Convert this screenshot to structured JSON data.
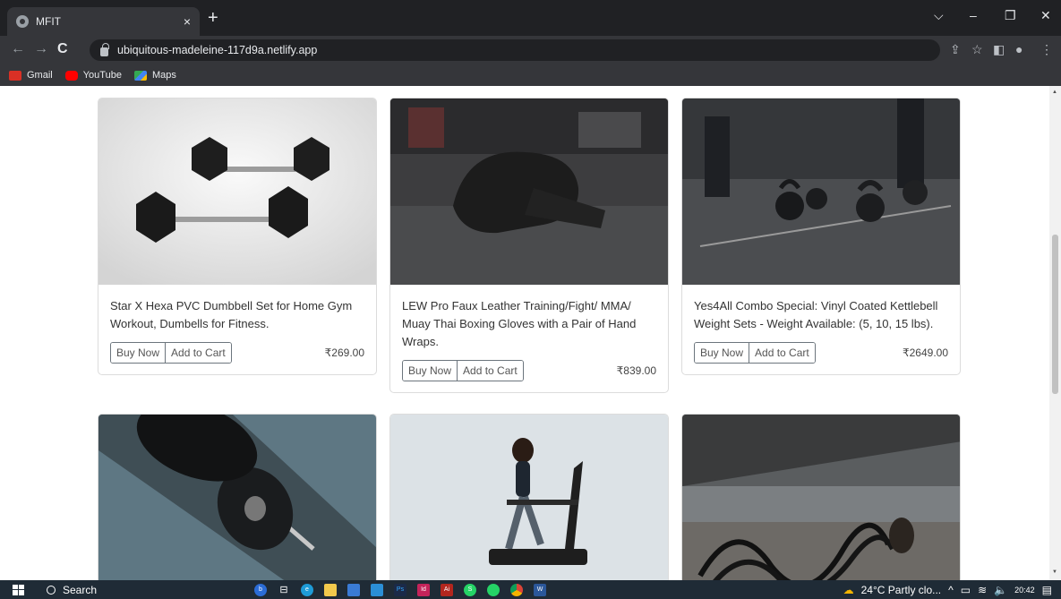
{
  "browser": {
    "tab_title": "MFIT",
    "tab_close": "×",
    "new_tab": "+",
    "window_controls": [
      "⌵",
      "–",
      "❐",
      "✕"
    ],
    "url": "ubiquitous-madeleine-117d9a.netlify.app",
    "nav": {
      "back": "←",
      "forward": "→",
      "reload": "C"
    },
    "toolbar_icons": [
      "share-icon",
      "star-icon",
      "sidepanel-icon",
      "profile-icon",
      "menu-icon"
    ],
    "bookmarks": [
      {
        "label": "Gmail",
        "icon": "gmail-icon",
        "color": "#d93025"
      },
      {
        "label": "YouTube",
        "icon": "youtube-icon",
        "color": "#ff0000"
      },
      {
        "label": "Maps",
        "icon": "maps-icon",
        "color": "#34a853"
      }
    ]
  },
  "products": [
    {
      "title": "Star X Hexa PVC Dumbbell Set for Home Gym Workout, Dumbells for Fitness.",
      "buy_label": "Buy Now",
      "cart_label": "Add to Cart",
      "price": "₹269.00",
      "image": "dumbbells"
    },
    {
      "title": "LEW Pro Faux Leather Training/Fight/ MMA/ Muay Thai Boxing Gloves with a Pair of Hand Wraps.",
      "buy_label": "Buy Now",
      "cart_label": "Add to Cart",
      "price": "₹839.00",
      "image": "boxing-gloves"
    },
    {
      "title": "Yes4All Combo Special: Vinyl Coated Kettlebell Weight Sets - Weight Available: (5, 10, 15 lbs).",
      "buy_label": "Buy Now",
      "cart_label": "Add to Cart",
      "price": "₹2649.00",
      "image": "kettlebells"
    },
    {
      "title": "",
      "image": "barbell"
    },
    {
      "title": "",
      "image": "treadmill"
    },
    {
      "title": "",
      "image": "battle-ropes"
    }
  ],
  "taskbar": {
    "search_label": "Search",
    "weather": "24°C  Partly clo...",
    "clock": "20:42",
    "apps": [
      {
        "icon": "bing-icon",
        "color": "#2b6cd6",
        "text": "b"
      },
      {
        "icon": "taskview-icon",
        "color": "#1f2b36",
        "text": "⊟"
      },
      {
        "icon": "edge-icon",
        "color": "#1e9bd7",
        "text": "e"
      },
      {
        "icon": "explorer-icon",
        "color": "#f2c94c",
        "text": ""
      },
      {
        "icon": "store-icon",
        "color": "#3a7bd5",
        "text": ""
      },
      {
        "icon": "mail-icon",
        "color": "#2b8fd6",
        "text": ""
      },
      {
        "icon": "photoshop-icon",
        "color": "#1b2a48",
        "text": "Ps"
      },
      {
        "icon": "indesign-icon",
        "color": "#c4245a",
        "text": "Id"
      },
      {
        "icon": "acrobat-icon",
        "color": "#b3261e",
        "text": "Ai"
      },
      {
        "icon": "whatsapp-business-icon",
        "color": "#25d366",
        "text": "S"
      },
      {
        "icon": "whatsapp-icon",
        "color": "#25d366",
        "text": "W"
      },
      {
        "icon": "chrome-icon",
        "color": "#f4b400",
        "text": ""
      },
      {
        "icon": "word-icon",
        "color": "#2b579a",
        "text": "W"
      }
    ]
  }
}
